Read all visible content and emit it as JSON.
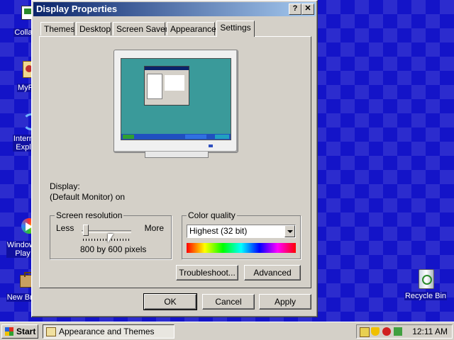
{
  "desktop": {
    "icons": [
      {
        "label": "Collab"
      },
      {
        "label": "MyP"
      },
      {
        "label": "Interne\nExplo"
      },
      {
        "label": "Windows\nPlay"
      },
      {
        "label": "New Brie"
      },
      {
        "label": "Recycle Bin"
      }
    ]
  },
  "window": {
    "title": "Display Properties",
    "help_btn": "?",
    "close_btn": "✕",
    "tabs": [
      "Themes",
      "Desktop",
      "Screen Saver",
      "Appearance",
      "Settings"
    ],
    "active_tab": "Settings",
    "display_label": "Display:",
    "display_value": "(Default Monitor) on",
    "resolution": {
      "legend": "Screen resolution",
      "less": "Less",
      "more": "More",
      "value": "800 by 600 pixels",
      "slider_level": 0.1
    },
    "color_quality": {
      "legend": "Color quality",
      "selected": "Highest (32 bit)"
    },
    "buttons": {
      "troubleshoot": "Troubleshoot...",
      "advanced": "Advanced",
      "ok": "OK",
      "cancel": "Cancel",
      "apply": "Apply"
    }
  },
  "taskbar": {
    "start": "Start",
    "task": "Appearance and Themes",
    "clock": "12:11 AM"
  },
  "colors": {
    "desktop_bg": "#1414c8",
    "title_start": "#0a246a",
    "title_end": "#a6caf0",
    "face": "#d4d0c8",
    "monitor_screen": "#3a9a9a"
  }
}
